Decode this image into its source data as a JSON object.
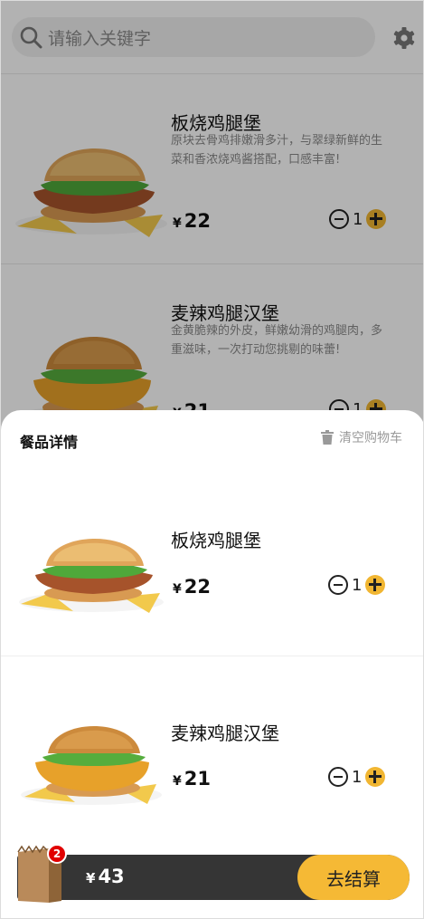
{
  "search": {
    "placeholder": "请输入关键字"
  },
  "menu": [
    {
      "name": "板烧鸡腿堡",
      "desc": "原块去骨鸡排嫩滑多汁，与翠绿新鲜的生菜和香浓烧鸡酱搭配，口感丰富!",
      "price_symbol": "¥",
      "price": "22",
      "qty": "1"
    },
    {
      "name": "麦辣鸡腿汉堡",
      "desc": "金黄脆辣的外皮，鲜嫩幼滑的鸡腿肉，多重滋味，一次打动您挑剔的味蕾!",
      "price_symbol": "¥",
      "price": "21",
      "qty": "1"
    }
  ],
  "cart": {
    "title": "餐品详情",
    "clear_label": "清空购物车",
    "items": [
      {
        "name": "板烧鸡腿堡",
        "price_symbol": "¥",
        "price": "22",
        "qty": "1"
      },
      {
        "name": "麦辣鸡腿汉堡",
        "price_symbol": "¥",
        "price": "21",
        "qty": "1"
      }
    ],
    "count": "2",
    "total_symbol": "¥",
    "total": "43",
    "checkout_label": "去结算"
  },
  "colors": {
    "accent": "#f5b935",
    "badge": "#e10000",
    "bar": "#353535"
  }
}
